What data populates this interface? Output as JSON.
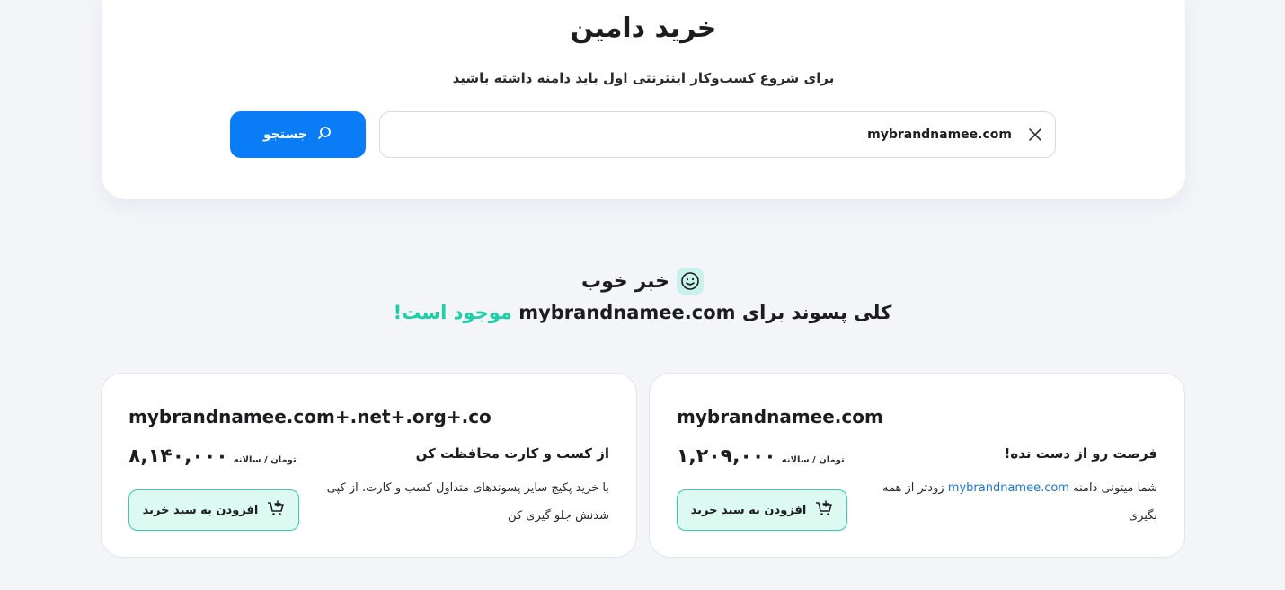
{
  "search": {
    "title": "خرید دامین",
    "subtitle": "برای شروع کسب‌وکار اینترنتی اول باید دامنه داشته باشید",
    "input_value": "mybrandnamee.com",
    "button_label": "جستجو"
  },
  "result": {
    "good_news": "خبر خوب",
    "line_prefix": "کلی پسوند برای",
    "domain": "mybrandnamee.com",
    "line_suffix": "موجود است!",
    "accent_color": "#1ccfa6"
  },
  "cards": [
    {
      "domain": "mybrandnamee.com",
      "price": "۱,۲۰۹,۰۰۰",
      "price_unit": "تومان / سالانه",
      "title": "فرصت رو از دست نده!",
      "desc_before": "شما میتونی دامنه",
      "desc_link": "mybrandnamee.com",
      "desc_after": "زودتر از همه بگیری",
      "button_label": "افزودن به سبد خرید"
    },
    {
      "domain": "mybrandnamee.com+.net+.org+.co",
      "price": "۸,۱۴۰,۰۰۰",
      "price_unit": "تومان / سالانه",
      "title": "از کسب و کارت محافظت کن",
      "desc": "با خرید پکیج سایر پسوندهای متداول کسب و کارت، از کپی شدنش جلو گیری کن",
      "button_label": "افزودن به سبد خرید"
    }
  ],
  "colors": {
    "primary": "#0a7cf6",
    "success": "#1ccfa6",
    "background": "#f4f5f9"
  }
}
